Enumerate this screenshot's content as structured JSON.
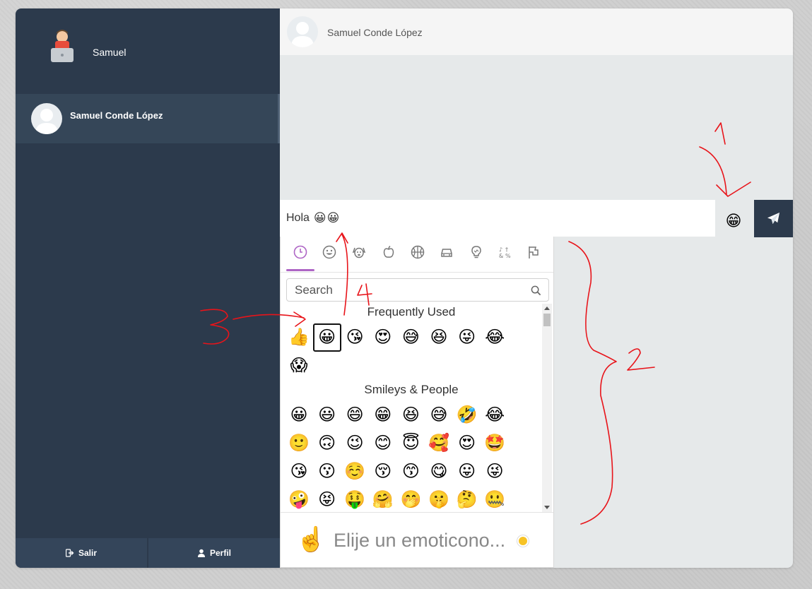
{
  "sidebar": {
    "user_name": "Samuel",
    "contacts": [
      {
        "name": "Samuel Conde López"
      }
    ],
    "footer": {
      "logout_label": "Salir",
      "profile_label": "Perfil"
    }
  },
  "chat": {
    "header_title": "Samuel Conde López",
    "message_text": "Hola",
    "message_emojis": "😀😀",
    "emoji_button": "😁",
    "send_icon": "paper-plane-icon"
  },
  "picker": {
    "tabs": [
      "clock-icon",
      "smiley-icon",
      "dog-icon",
      "apple-icon",
      "basketball-icon",
      "car-icon",
      "lightbulb-icon",
      "symbols-icon",
      "flags-icon"
    ],
    "search_placeholder": "Search",
    "categories": [
      {
        "title": "Frequently Used",
        "emojis": [
          "👍",
          "😀",
          "😘",
          "😍",
          "😅",
          "😆",
          "😜",
          "😂",
          "😱"
        ]
      },
      {
        "title": "Smileys & People",
        "emojis": [
          "😀",
          "😃",
          "😄",
          "😁",
          "😆",
          "😅",
          "🤣",
          "😂",
          "🙂",
          "🙃",
          "😉",
          "😊",
          "😇",
          "🥰",
          "😍",
          "🤩",
          "😘",
          "😗",
          "☺️",
          "😚",
          "😙",
          "😋",
          "😛",
          "😜",
          "🤪",
          "😝",
          "🤑",
          "🤗",
          "🤭",
          "🤫",
          "🤔",
          "🤐"
        ]
      }
    ],
    "preview_emoji": "☝️",
    "preview_text": "Elije un emoticono..."
  },
  "annotations": [
    "1",
    "2",
    "3",
    "4"
  ],
  "colors": {
    "sidebar_bg": "#2c3a4c",
    "accent_tab": "#ae65c5",
    "annotation": "#e8141a"
  }
}
